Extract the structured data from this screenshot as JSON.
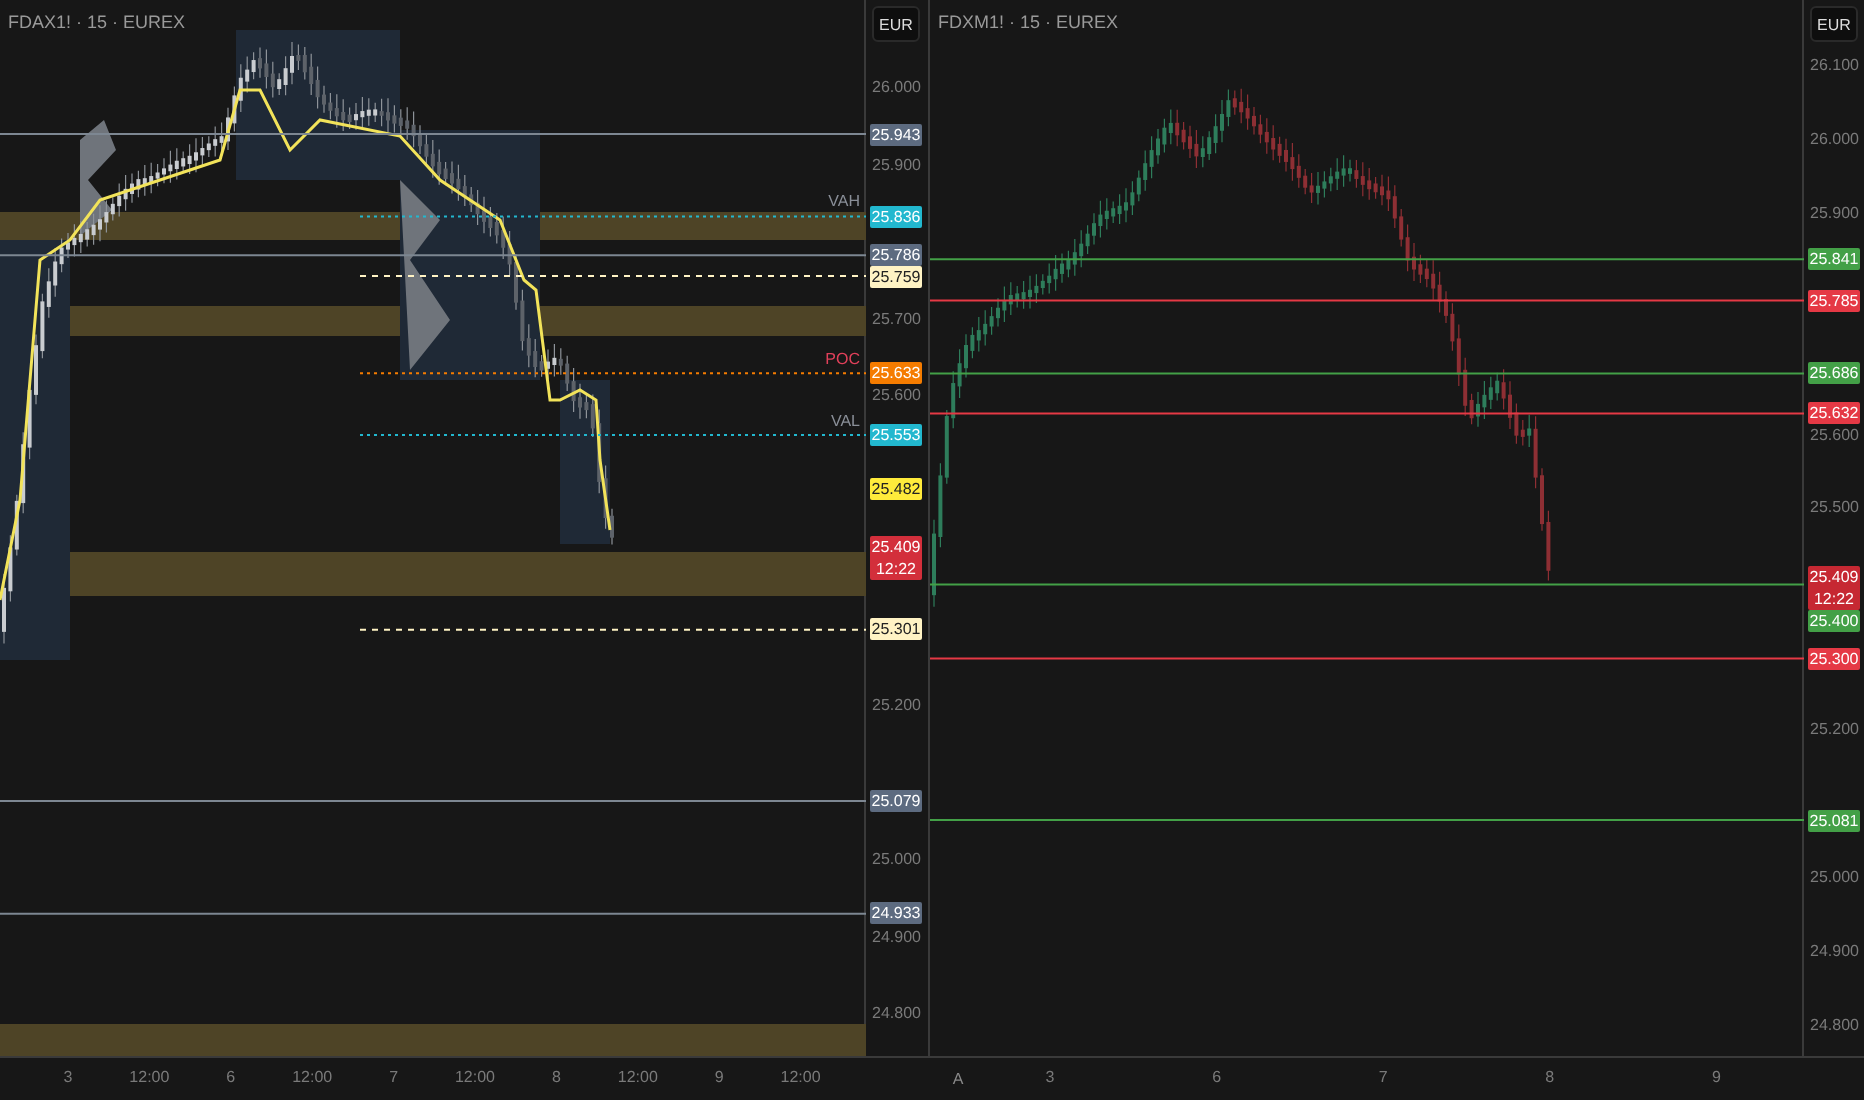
{
  "panes": [
    {
      "title": "FDAX1! · 15 · EUREX",
      "currency": "EUR",
      "ticks": [
        "26.000",
        "25.900",
        "25.700",
        "25.600",
        "25.200",
        "25.000",
        "24.900",
        "24.800"
      ],
      "tags": [
        {
          "text": "25.943",
          "color": "#5d6b80",
          "kind": "solid"
        },
        {
          "text": "25.836",
          "color": "#22b8cf",
          "kind": "dotted",
          "note": {
            "text": "VAH",
            "color": "#8a8f98"
          }
        },
        {
          "text": "25.786",
          "color": "#5d6b80",
          "kind": "solid"
        },
        {
          "text": "25.759",
          "color": "#fff3c4",
          "kind": "dashed"
        },
        {
          "text": "25.633",
          "color": "#f57c00",
          "kind": "dotted",
          "note": {
            "text": "POC",
            "color": "#e0405a"
          }
        },
        {
          "text": "25.553",
          "color": "#22b8cf",
          "kind": "dotted",
          "note": {
            "text": "VAL",
            "color": "#8a8f98"
          }
        },
        {
          "text": "25.482",
          "color": "#ffeb3b",
          "kind": "none"
        },
        {
          "text": "25.409",
          "time": "12:22",
          "color": "#d32f3b",
          "kind": "none"
        },
        {
          "text": "25.301",
          "color": "#fff3c4",
          "kind": "dashed"
        },
        {
          "text": "25.079",
          "color": "#5d6b80",
          "kind": "solid"
        },
        {
          "text": "24.933",
          "color": "#5d6b80",
          "kind": "solid"
        }
      ],
      "time_labels": [
        "3",
        "12:00",
        "6",
        "12:00",
        "7",
        "12:00",
        "8",
        "12:00",
        "9",
        "12:00"
      ]
    },
    {
      "title": "FDXM1! · 15 · EUREX",
      "currency": "EUR",
      "auto_button": "A",
      "ticks": [
        "26.100",
        "26.000",
        "25.900",
        "25.600",
        "25.500",
        "25.200",
        "25.000",
        "24.900",
        "24.800"
      ],
      "tags": [
        {
          "text": "25.841",
          "color": "#43a047",
          "kind": "solid"
        },
        {
          "text": "25.785",
          "color": "#e53945",
          "kind": "solid"
        },
        {
          "text": "25.686",
          "color": "#43a047",
          "kind": "solid"
        },
        {
          "text": "25.632",
          "color": "#e53945",
          "kind": "solid"
        },
        {
          "text": "25.409",
          "time": "12:22",
          "color": "#c62832",
          "kind": "none"
        },
        {
          "text": "25.400",
          "color": "#43a047",
          "kind": "solid"
        },
        {
          "text": "25.300",
          "color": "#e53945",
          "kind": "solid"
        },
        {
          "text": "25.081",
          "color": "#43a047",
          "kind": "solid"
        }
      ],
      "time_labels": [
        "3",
        "6",
        "7",
        "8",
        "9"
      ]
    }
  ]
}
